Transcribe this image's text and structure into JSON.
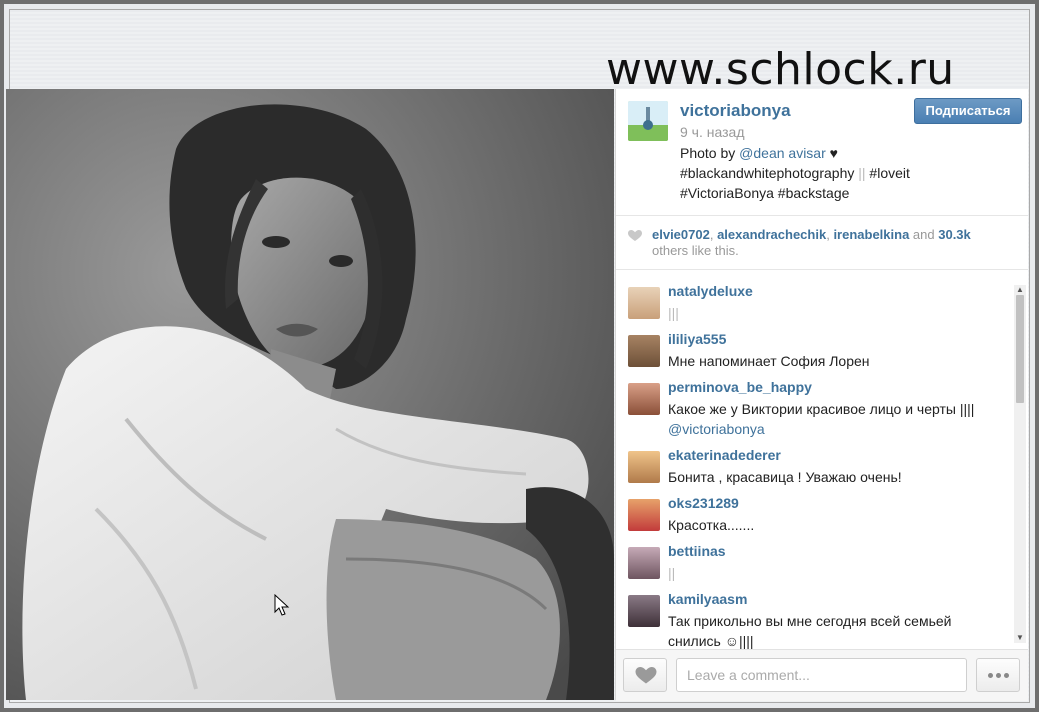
{
  "watermark": "www.schlock.ru",
  "post": {
    "author": "victoriabonya",
    "time_ago": "9 ч. назад",
    "follow_label": "Подписаться",
    "caption": {
      "prefix": "Photo by ",
      "mention": "@dean",
      "mention_rest": "avisar",
      "heart": "♥",
      "line2": "#blackandwhitephotography",
      "line2_marks": "||",
      "line2_tag": "#loveit",
      "line3": "#VictoriaBonya #backstage"
    }
  },
  "likes": {
    "users": [
      "elvie0702",
      "alexandrachechik",
      "irenabelkina"
    ],
    "sep1": ", ",
    "sep2": ", ",
    "and_text": " and ",
    "count": "30.3k",
    "suffix": "others like this."
  },
  "comments": [
    {
      "user": "natalydeluxe",
      "text": "|||",
      "avatar_color": "#d7b48e"
    },
    {
      "user": "ililiya555",
      "text": "Мне напоминает София Лорен",
      "avatar_color": "#8a6a4c"
    },
    {
      "user": "perminova_be_happy",
      "text": "Какое же у Виктории красивое лицо и черты ||||",
      "mention": "@victoriabonya",
      "avatar_color": "#b06a4a"
    },
    {
      "user": "ekaterinadederer",
      "text": "Бонита , красавица ! Уважаю очень!",
      "avatar_color": "#c59a6b"
    },
    {
      "user": "oks231289",
      "text": "Красотка.......",
      "avatar_color": "#c8574b"
    },
    {
      "user": "bettiinas",
      "text": "||",
      "avatar_color": "#9a7f8d"
    },
    {
      "user": "kamilyaasm",
      "text": "Так прикольно вы мне сегодня всей семьей",
      "text2": "снились ☺||||",
      "avatar_color": "#6b5b66"
    }
  ],
  "comment_box": {
    "placeholder": "Leave a comment..."
  },
  "colors": {
    "username": "#3f729b",
    "follow_button": "#4a7fb3"
  },
  "icons": {
    "like": "heart-icon",
    "more": "ellipsis-icon",
    "cursor": "mouse-cursor-icon"
  }
}
